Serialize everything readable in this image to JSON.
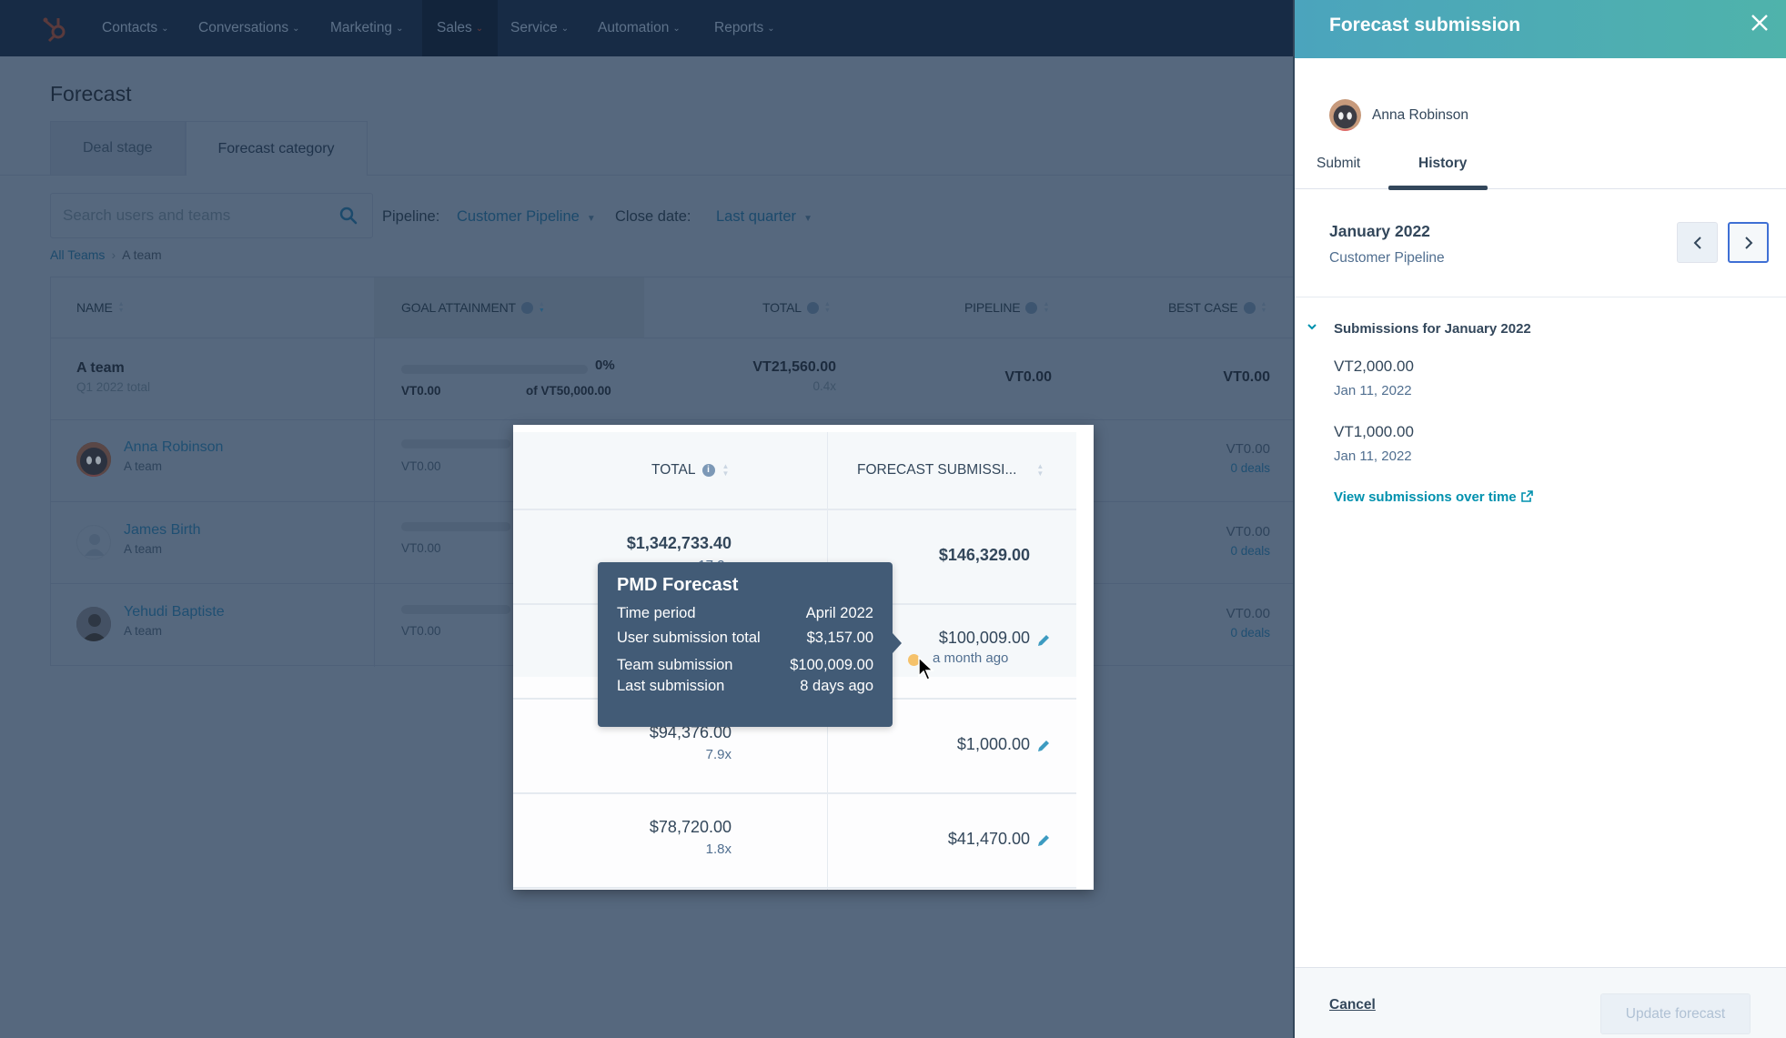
{
  "topnav": {
    "items": [
      {
        "label": "Contacts"
      },
      {
        "label": "Conversations"
      },
      {
        "label": "Marketing"
      },
      {
        "label": "Sales",
        "active": true
      },
      {
        "label": "Service"
      },
      {
        "label": "Automation"
      },
      {
        "label": "Reports"
      }
    ]
  },
  "page": {
    "title": "Forecast",
    "tabs": [
      {
        "label": "Deal stage"
      },
      {
        "label": "Forecast category",
        "active": true
      }
    ],
    "search_placeholder": "Search users and teams",
    "filters": {
      "pipeline_label": "Pipeline:",
      "pipeline_value": "Customer Pipeline",
      "close_date_label": "Close date:",
      "close_date_value": "Last quarter"
    },
    "breadcrumb": {
      "root": "All Teams",
      "current": "A team"
    }
  },
  "table": {
    "columns": [
      "NAME",
      "GOAL ATTAINMENT",
      "TOTAL",
      "PIPELINE",
      "BEST CASE"
    ],
    "team_row": {
      "name": "A team",
      "subtitle": "Q1 2022 total",
      "goal_percent": "0%",
      "goal_current": "VT0.00",
      "goal_target": "of VT50,000.00",
      "goal_progress": 0,
      "total": "VT21,560.00",
      "total_multiplier": "0.4x",
      "pipeline": "VT0.00",
      "best_case": "VT0.00"
    },
    "rows": [
      {
        "name": "Anna Robinson",
        "team": "A team",
        "goal_current": "VT0.00",
        "best_case": "VT0.00",
        "best_case_deals": "0 deals"
      },
      {
        "name": "James Birth",
        "team": "A team",
        "goal_current": "VT0.00",
        "best_case": "VT0.00",
        "best_case_deals": "0 deals"
      },
      {
        "name": "Yehudi Baptiste",
        "team": "A team",
        "goal_current": "VT0.00",
        "best_case": "VT0.00",
        "best_case_deals": "0 deals"
      }
    ]
  },
  "overlay": {
    "columns": [
      "TOTAL",
      "FORECAST SUBMISSI..."
    ],
    "rows": [
      {
        "total": "$1,342,733.40",
        "multiplier": "17.2x",
        "submission": "$146,329.00"
      },
      {
        "total": "",
        "multiplier": "",
        "submission": "$100,009.00",
        "submission_ago": "a month ago"
      },
      {
        "total": "$94,376.00",
        "multiplier": "7.9x",
        "submission": "$1,000.00"
      },
      {
        "total": "$78,720.00",
        "multiplier": "1.8x",
        "submission": "$41,470.00"
      }
    ],
    "tooltip": {
      "title": "PMD Forecast",
      "rows": [
        {
          "label": "Time period",
          "value": "April 2022"
        },
        {
          "label": "User submission total",
          "value": "$3,157.00"
        },
        {
          "label": "Team submission",
          "value": "$100,009.00"
        },
        {
          "label": "Last submission",
          "value": "8 days ago"
        }
      ]
    }
  },
  "panel": {
    "title": "Forecast submission",
    "user": "Anna Robinson",
    "tabs": [
      {
        "label": "Submit"
      },
      {
        "label": "History",
        "active": true
      }
    ],
    "period": "January 2022",
    "pipeline": "Customer Pipeline",
    "section_title": "Submissions for January 2022",
    "submissions": [
      {
        "amount": "VT2,000.00",
        "date": "Jan 11, 2022"
      },
      {
        "amount": "VT1,000.00",
        "date": "Jan 11, 2022"
      }
    ],
    "view_link": "View submissions over time",
    "cancel_label": "Cancel",
    "update_label": "Update forecast"
  },
  "colors": {
    "panel_header_start": "#4ba4bd",
    "panel_header_end": "#4fb3ab",
    "link": "#0091ae",
    "tooltip_bg": "#425b76",
    "status_dot": "#f5c26b",
    "nav_bg": "#172b45"
  }
}
